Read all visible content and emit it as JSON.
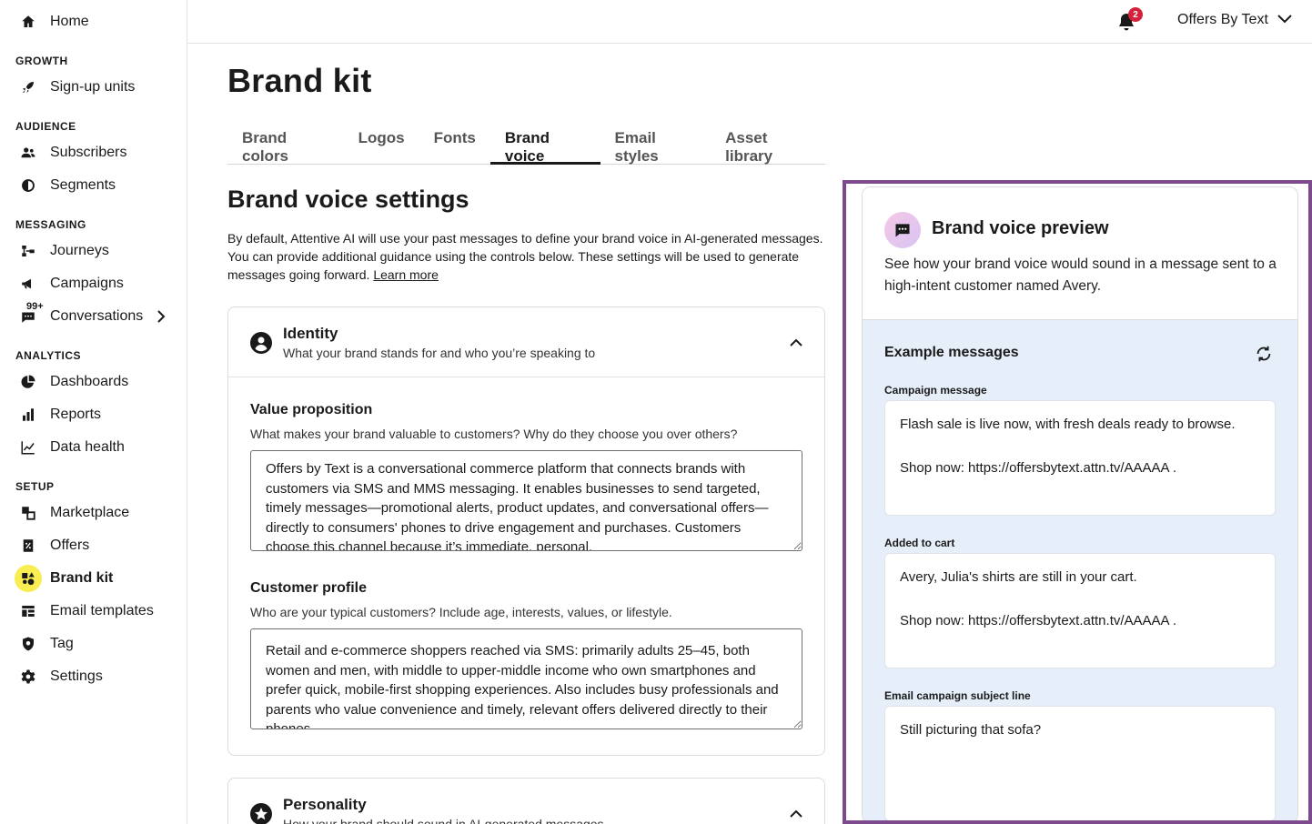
{
  "sidebar": {
    "items": [
      {
        "label": "Home",
        "icon": "home-icon"
      },
      {
        "label": "Sign-up units",
        "icon": "rocket-icon"
      },
      {
        "label": "Subscribers",
        "icon": "people-icon"
      },
      {
        "label": "Segments",
        "icon": "segments-icon"
      },
      {
        "label": "Journeys",
        "icon": "journeys-icon"
      },
      {
        "label": "Campaigns",
        "icon": "megaphone-icon"
      },
      {
        "label": "Conversations",
        "icon": "chat-icon",
        "badge": "99+"
      },
      {
        "label": "Dashboards",
        "icon": "pie-chart-icon"
      },
      {
        "label": "Reports",
        "icon": "bar-chart-icon"
      },
      {
        "label": "Data health",
        "icon": "line-chart-icon"
      },
      {
        "label": "Marketplace",
        "icon": "marketplace-icon"
      },
      {
        "label": "Offers",
        "icon": "offers-icon"
      },
      {
        "label": "Brand kit",
        "icon": "brand-kit-icon",
        "active": true
      },
      {
        "label": "Email templates",
        "icon": "template-icon"
      },
      {
        "label": "Tag",
        "icon": "tag-shield-icon"
      },
      {
        "label": "Settings",
        "icon": "gear-icon"
      }
    ],
    "sections": {
      "growth": "GROWTH",
      "audience": "AUDIENCE",
      "messaging": "MESSAGING",
      "analytics": "ANALYTICS",
      "setup": "SETUP"
    }
  },
  "topbar": {
    "notification_count": "2",
    "account_name": "Offers By Text"
  },
  "page": {
    "title": "Brand kit",
    "tabs": [
      "Brand colors",
      "Logos",
      "Fonts",
      "Brand voice",
      "Email styles",
      "Asset library"
    ],
    "active_tab": "Brand voice"
  },
  "brand_voice": {
    "title": "Brand voice settings",
    "intro": "By default, Attentive AI will use your past messages to define your brand voice in AI-generated messages. You can provide additional guidance using the controls below. These settings will be used to generate messages going forward.",
    "learn_more": "Learn more",
    "identity": {
      "title": "Identity",
      "subtitle": "What your brand stands for and who you’re speaking to",
      "value_prop_label": "Value proposition",
      "value_prop_help": "What makes your brand valuable to customers? Why do they choose you over others?",
      "value_prop_value": "Offers by Text is a conversational commerce platform that connects brands with customers via SMS and MMS messaging. It enables businesses to send targeted, timely messages—promotional alerts, product updates, and conversational offers—directly to consumers' phones to drive engagement and purchases. Customers choose this channel because it’s immediate, personal,",
      "customer_label": "Customer profile",
      "customer_help": "Who are your typical customers? Include age, interests, values, or lifestyle.",
      "customer_value": "Retail and e-commerce shoppers reached via SMS: primarily adults 25–45, both women and men, with middle to upper-middle income who own smartphones and prefer quick, mobile-first shopping experiences. Also includes busy professionals and parents who value convenience and timely, relevant offers delivered directly to their phones."
    },
    "personality": {
      "title": "Personality",
      "subtitle": "How your brand should sound in AI-generated messages"
    }
  },
  "preview": {
    "title": "Brand voice preview",
    "description": "See how your brand voice would sound in a message sent to a high-intent customer named Avery.",
    "examples_title": "Example messages",
    "messages": [
      {
        "label": "Campaign message",
        "text": "Flash sale is live now, with fresh deals ready to browse.\n\nShop now: https://offersbytext.attn.tv/AAAAA ."
      },
      {
        "label": "Added to cart",
        "text": "Avery, Julia's shirts are still in your cart.\n\nShop now: https://offersbytext.attn.tv/AAAAA ."
      },
      {
        "label": "Email campaign subject line",
        "text": "Still picturing that sofa?"
      }
    ]
  }
}
